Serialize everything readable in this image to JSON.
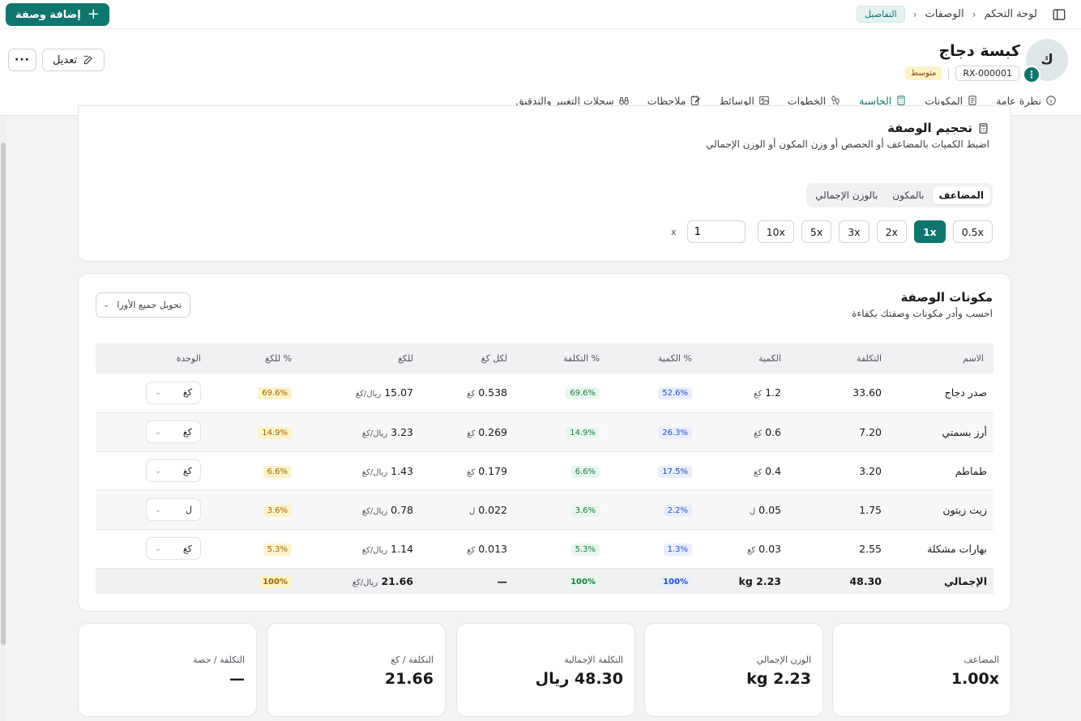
{
  "topbar": {
    "breadcrumb": [
      "لوحة التحكم",
      "الوصفات",
      "التفاصيل"
    ],
    "add_button_label": "إضافة وصفة"
  },
  "recipe": {
    "avatar_letter": "ك",
    "avatar_action": "⋮",
    "title": "كبسة دجاج",
    "code": "RX-000001",
    "difficulty": "متوسط"
  },
  "actions": {
    "edit_label": "تعديل",
    "more_label": "···"
  },
  "tabs": [
    {
      "label": "نظرة عامة",
      "icon": "info-icon"
    },
    {
      "label": "المكونات",
      "icon": "list-icon"
    },
    {
      "label": "الحاسبة",
      "icon": "calculator-icon",
      "active": true
    },
    {
      "label": "الخطوات",
      "icon": "footprints-icon"
    },
    {
      "label": "الوسائط",
      "icon": "image-icon"
    },
    {
      "label": "ملاحظات",
      "icon": "notes-icon"
    },
    {
      "label": "سجلات التغيير والتدقيق",
      "icon": "binoculars-icon"
    }
  ],
  "scaling": {
    "title": "تحجيم الوصفة",
    "subtitle": "اضبط الكميات بالمضاعف أو الحصص أو وزن المكون أو الوزن الإجمالي",
    "modes": [
      "المضاعف",
      "بالمكون",
      "بالوزن الإجمالي"
    ],
    "active_mode": "المضاعف",
    "multipliers": [
      "0.5x",
      "1x",
      "2x",
      "3x",
      "5x",
      "10x"
    ],
    "active_multiplier": "1x",
    "custom_value": "1",
    "custom_suffix": "x"
  },
  "ingredients": {
    "title": "مكونات الوصفة",
    "subtitle": "احسب وأدر مكونات وصفتك بكفاءة",
    "convert_label": "تحويل جميع الأوزا",
    "columns": [
      "الاسم",
      "التكلفة",
      "الكمية",
      "% الكمية",
      "% التكلفة",
      "لكل كغ",
      "للكغ",
      "% للكغ",
      "الوحدة"
    ],
    "rows": [
      {
        "name": "صدر دجاج",
        "cost": "33.60",
        "qty": "1.2",
        "qty_unit": "كغ",
        "qty_pct": "52.6%",
        "cost_pct": "69.6%",
        "per_kg": "0.538",
        "per_kg_unit": "كغ",
        "cost_per_kg": "15.07",
        "cost_per_kg_unit": "ريال/كغ",
        "kg_pct": "69.6%",
        "unit": "كغ"
      },
      {
        "name": "أرز بسمتي",
        "cost": "7.20",
        "qty": "0.6",
        "qty_unit": "كغ",
        "qty_pct": "26.3%",
        "cost_pct": "14.9%",
        "per_kg": "0.269",
        "per_kg_unit": "كغ",
        "cost_per_kg": "3.23",
        "cost_per_kg_unit": "ريال/كغ",
        "kg_pct": "14.9%",
        "unit": "كغ"
      },
      {
        "name": "طماطم",
        "cost": "3.20",
        "qty": "0.4",
        "qty_unit": "كغ",
        "qty_pct": "17.5%",
        "cost_pct": "6.6%",
        "per_kg": "0.179",
        "per_kg_unit": "كغ",
        "cost_per_kg": "1.43",
        "cost_per_kg_unit": "ريال/كغ",
        "kg_pct": "6.6%",
        "unit": "كغ"
      },
      {
        "name": "زيت زيتون",
        "cost": "1.75",
        "qty": "0.05",
        "qty_unit": "ل",
        "qty_pct": "2.2%",
        "cost_pct": "3.6%",
        "per_kg": "0.022",
        "per_kg_unit": "ل",
        "cost_per_kg": "0.78",
        "cost_per_kg_unit": "ريال/كغ",
        "kg_pct": "3.6%",
        "unit": "ل"
      },
      {
        "name": "بهارات مشكلة",
        "cost": "2.55",
        "qty": "0.03",
        "qty_unit": "كغ",
        "qty_pct": "1.3%",
        "cost_pct": "5.3%",
        "per_kg": "0.013",
        "per_kg_unit": "كغ",
        "cost_per_kg": "1.14",
        "cost_per_kg_unit": "ريال/كغ",
        "kg_pct": "5.3%",
        "unit": "كغ"
      }
    ],
    "total": {
      "name": "الإجمالي",
      "cost": "48.30",
      "qty": "kg 2.23",
      "qty_pct": "100%",
      "cost_pct": "100%",
      "per_kg": "—",
      "cost_per_kg": "21.66",
      "cost_per_kg_unit": "ريال/كغ",
      "kg_pct": "100%"
    }
  },
  "stats": [
    {
      "label": "المضاعف",
      "value": "1.00x"
    },
    {
      "label": "الوزن الإجمالي",
      "value": "kg 2.23"
    },
    {
      "label": "التكلفة الإجمالية",
      "value": "48.30 ريال"
    },
    {
      "label": "التكلفة / كغ",
      "value": "21.66"
    },
    {
      "label": "التكلفة / حصة",
      "value": "—"
    }
  ],
  "colors": {
    "accent": "#0f766e",
    "qty_pct": "#1d4ed8",
    "cost_pct": "#15803d",
    "kg_pct": "#a16207",
    "difficulty_badge": "#fdf3c7"
  }
}
